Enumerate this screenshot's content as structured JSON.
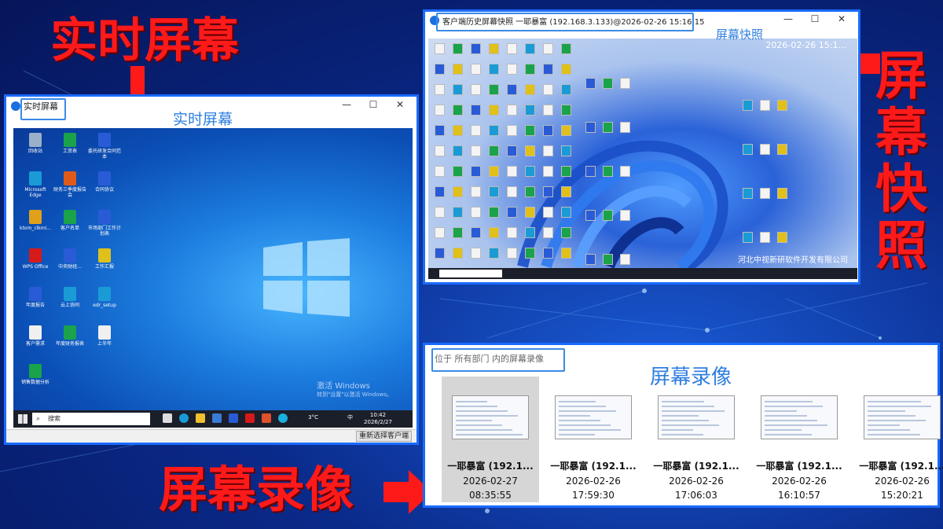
{
  "labels": {
    "realtime_big": "实时屏幕",
    "snapshot_big": "屏幕快照",
    "recording_big": "屏幕录像"
  },
  "realtime_window": {
    "title": "实时屏幕",
    "caption": "实时屏幕",
    "controls": [
      "—",
      "☐",
      "✕"
    ],
    "desktop_icons": [
      {
        "label": "回收站",
        "color": "#9ab0c8"
      },
      {
        "label": "工资表",
        "color": "#1aa34a"
      },
      {
        "label": "委托研发合同范本",
        "color": "#2a5bd6"
      },
      {
        "label": "Microsoft Edge",
        "color": "#1a9bd6"
      },
      {
        "label": "财务三季度报告会",
        "color": "#e05a1a"
      },
      {
        "label": "合同协议",
        "color": "#2a5bd6"
      },
      {
        "label": "ktom_clkmi...",
        "color": "#e0a01a"
      },
      {
        "label": "客户名单",
        "color": "#1aa34a"
      },
      {
        "label": "市场部门工作计划表",
        "color": "#2a5bd6"
      },
      {
        "label": "WPS Office",
        "color": "#d61a1a"
      },
      {
        "label": "中央财经...",
        "color": "#2a5bd6"
      },
      {
        "label": "工作汇报",
        "color": "#e0c01a"
      },
      {
        "label": "年度报告",
        "color": "#2a5bd6"
      },
      {
        "label": "云上协同",
        "color": "#1a9bd6"
      },
      {
        "label": "edr_setup",
        "color": "#1a9bd6"
      },
      {
        "label": "客户需求",
        "color": "#f0f0f0"
      },
      {
        "label": "年度财务报表",
        "color": "#1aa34a"
      },
      {
        "label": "上半年",
        "color": "#f0f0f0"
      },
      {
        "label": "销售数据分析",
        "color": "#1aa34a"
      }
    ],
    "taskbar": {
      "search": "搜索",
      "weather": "3°C",
      "ime": "中",
      "time": "10:42",
      "date": "2026/2/27"
    },
    "activation": {
      "line1": "激活 Windows",
      "line2": "转到\"设置\"以激活 Windows。"
    },
    "status_button": "重新选择客户端"
  },
  "snapshot_window": {
    "title": "客户端历史屏幕快照 一耶暴富 (192.168.3.133)@2026-02-26 15:16:15",
    "caption": "屏幕快照",
    "timestamp": "2026-02-26 15:1...",
    "controls": [
      "—",
      "☐",
      "✕"
    ],
    "watermark": "河北中视新研软件开发有限公司"
  },
  "recording_panel": {
    "location": "位于 所有部门 内的屏幕录像",
    "caption": "屏幕录像",
    "items": [
      {
        "name": "一耶暴富 (192.1...",
        "date": "2026-02-27",
        "time": "08:35:55",
        "selected": true
      },
      {
        "name": "一耶暴富 (192.1...",
        "date": "2026-02-26",
        "time": "17:59:30",
        "selected": false
      },
      {
        "name": "一耶暴富 (192.1...",
        "date": "2026-02-26",
        "time": "17:06:03",
        "selected": false
      },
      {
        "name": "一耶暴富 (192.1...",
        "date": "2026-02-26",
        "time": "16:10:57",
        "selected": false
      },
      {
        "name": "一耶暴富 (192.1...",
        "date": "2026-02-26",
        "time": "15:20:21",
        "selected": false
      }
    ]
  },
  "colors": {
    "accent": "#1a6bff",
    "red": "#ff1a1a",
    "caption_blue": "#2f7fe0"
  }
}
